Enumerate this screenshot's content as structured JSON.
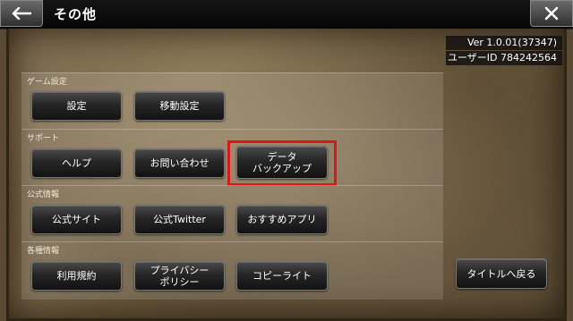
{
  "header": {
    "title": "その他"
  },
  "info": {
    "version": "Ver 1.0.01(37347)",
    "user_id": "ユーザーID 784242564"
  },
  "sections": [
    {
      "label": "ゲーム設定",
      "buttons": [
        "設定",
        "移動設定"
      ]
    },
    {
      "label": "サポート",
      "buttons": [
        "ヘルプ",
        "お問い合わせ",
        "データ\nバックアップ"
      ]
    },
    {
      "label": "公式情報",
      "buttons": [
        "公式サイト",
        "公式Twitter",
        "おすすめアプリ"
      ]
    },
    {
      "label": "各種情報",
      "buttons": [
        "利用規約",
        "プライバシー\nポリシー",
        "コピーライト"
      ]
    }
  ],
  "return_button": {
    "label": "タイトルへ戻る"
  },
  "colors": {
    "highlight": "#e0141c"
  },
  "icons": {
    "back": "back-arrow-icon",
    "close": "close-icon"
  }
}
